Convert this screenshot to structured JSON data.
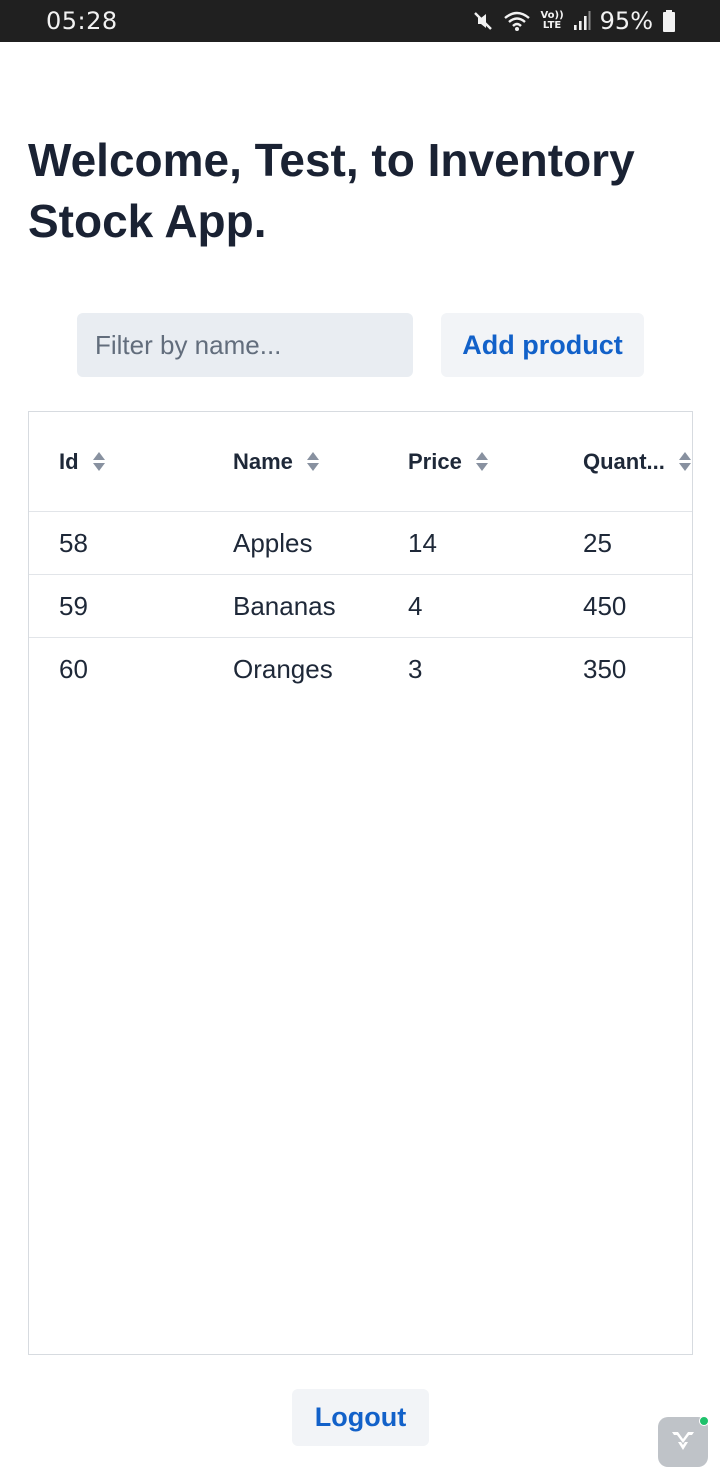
{
  "status_bar": {
    "time": "05:28",
    "volte_label": "Vo))",
    "lte_label": "LTE",
    "battery": "95%",
    "icons": [
      "mute-icon",
      "wifi-icon",
      "volte-icon",
      "signal-icon",
      "battery-icon"
    ]
  },
  "page": {
    "title": "Welcome, Test, to Inventory Stock App."
  },
  "toolbar": {
    "filter_placeholder": "Filter by name...",
    "filter_value": "",
    "add_label": "Add product"
  },
  "grid": {
    "columns": [
      {
        "label": "Id"
      },
      {
        "label": "Name"
      },
      {
        "label": "Price"
      },
      {
        "label": "Quant..."
      }
    ],
    "rows": [
      {
        "id": "58",
        "name": "Apples",
        "price": "14",
        "quantity": "25"
      },
      {
        "id": "59",
        "name": "Bananas",
        "price": "4",
        "quantity": "450"
      },
      {
        "id": "60",
        "name": "Oranges",
        "price": "3",
        "quantity": "350"
      }
    ]
  },
  "footer": {
    "logout_label": "Logout"
  },
  "colors": {
    "accent": "#1261c9",
    "title": "#1a2233",
    "status_bar": "#202020",
    "dev_badge_dot": "#1fc16b"
  }
}
